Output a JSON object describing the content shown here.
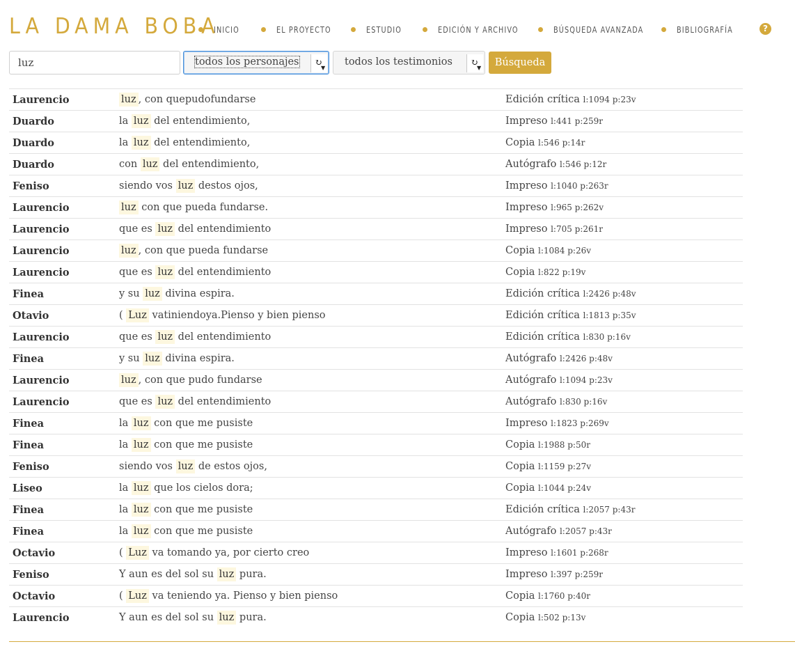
{
  "brand": {
    "title": "LA DAMA BOBA",
    "accent": "#d4a93c"
  },
  "nav": [
    {
      "label": "INICIO"
    },
    {
      "label": "EL PROYECTO"
    },
    {
      "label": "ESTUDIO"
    },
    {
      "label": "EDICIÓN Y ARCHIVO"
    },
    {
      "label": "BÚSQUEDA AVANZADA"
    },
    {
      "label": "BIBLIOGRAFÍA"
    }
  ],
  "help": {
    "icon": "question-circle-icon",
    "glyph": "?"
  },
  "search": {
    "query": "luz",
    "character_select": "todos los personajes",
    "witness_select": "todos los testimonios",
    "button_label": "Búsqueda"
  },
  "results": [
    {
      "character": "Laurencio",
      "pre": "",
      "match": "luz",
      "post": ", con quepudofundarse",
      "source": "Edición crítica",
      "ref": "l:1094 p:23v"
    },
    {
      "character": "Duardo",
      "pre": "la ",
      "match": "luz",
      "post": " del entendimiento,",
      "source": "Impreso",
      "ref": "l:441 p:259r"
    },
    {
      "character": "Duardo",
      "pre": "la ",
      "match": "luz",
      "post": " del entendimiento,",
      "source": "Copia",
      "ref": "l:546 p:14r"
    },
    {
      "character": "Duardo",
      "pre": "con ",
      "match": "luz",
      "post": " del entendimiento,",
      "source": "Autógrafo",
      "ref": "l:546 p:12r"
    },
    {
      "character": "Feniso",
      "pre": "siendo vos ",
      "match": "luz",
      "post": " destos ojos,",
      "source": "Impreso",
      "ref": "l:1040 p:263r"
    },
    {
      "character": "Laurencio",
      "pre": "",
      "match": "luz",
      "post": " con que pueda fundarse.",
      "source": "Impreso",
      "ref": "l:965 p:262v"
    },
    {
      "character": "Laurencio",
      "pre": "que es ",
      "match": "luz",
      "post": " del entendimiento",
      "source": "Impreso",
      "ref": "l:705 p:261r"
    },
    {
      "character": "Laurencio",
      "pre": "",
      "match": "luz",
      "post": ", con que pueda fundarse",
      "source": "Copia",
      "ref": "l:1084 p:26v"
    },
    {
      "character": "Laurencio",
      "pre": "que es ",
      "match": "luz",
      "post": " del entendimiento",
      "source": "Copia",
      "ref": "l:822 p:19v"
    },
    {
      "character": "Finea",
      "pre": "y su ",
      "match": "luz",
      "post": " divina espira.",
      "source": "Edición crítica",
      "ref": "l:2426 p:48v"
    },
    {
      "character": "Otavio",
      "pre": "( ",
      "match": "Luz",
      "post": " vatiniendoya.Pienso y bien pienso",
      "source": "Edición crítica",
      "ref": "l:1813 p:35v"
    },
    {
      "character": "Laurencio",
      "pre": "que es ",
      "match": "luz",
      "post": " del entendimiento",
      "source": "Edición crítica",
      "ref": "l:830 p:16v"
    },
    {
      "character": "Finea",
      "pre": "y su ",
      "match": "luz",
      "post": " divina espira.",
      "source": "Autógrafo",
      "ref": "l:2426 p:48v"
    },
    {
      "character": "Laurencio",
      "pre": "",
      "match": "luz",
      "post": ", con que pudo fundarse",
      "source": "Autógrafo",
      "ref": "l:1094 p:23v"
    },
    {
      "character": "Laurencio",
      "pre": "que es ",
      "match": "luz",
      "post": " del entendimiento",
      "source": "Autógrafo",
      "ref": "l:830 p:16v"
    },
    {
      "character": "Finea",
      "pre": "la ",
      "match": "luz",
      "post": " con que me pusiste",
      "source": "Impreso",
      "ref": "l:1823 p:269v"
    },
    {
      "character": "Finea",
      "pre": "la ",
      "match": "luz",
      "post": " con que me pusiste",
      "source": "Copia",
      "ref": "l:1988 p:50r"
    },
    {
      "character": "Feniso",
      "pre": "siendo vos ",
      "match": "luz",
      "post": " de estos ojos,",
      "source": "Copia",
      "ref": "l:1159 p:27v"
    },
    {
      "character": "Liseo",
      "pre": "la ",
      "match": "luz",
      "post": " que los cielos dora;",
      "source": "Copia",
      "ref": "l:1044 p:24v"
    },
    {
      "character": "Finea",
      "pre": "la ",
      "match": "luz",
      "post": " con que me pusiste",
      "source": "Edición crítica",
      "ref": "l:2057 p:43r"
    },
    {
      "character": "Finea",
      "pre": "la ",
      "match": "luz",
      "post": " con que me pusiste",
      "source": "Autógrafo",
      "ref": "l:2057 p:43r"
    },
    {
      "character": "Octavio",
      "pre": "( ",
      "match": "Luz",
      "post": " va tomando ya, por cierto creo",
      "source": "Impreso",
      "ref": "l:1601 p:268r"
    },
    {
      "character": "Feniso",
      "pre": "Y aun es del sol su ",
      "match": "luz",
      "post": " pura.",
      "source": "Impreso",
      "ref": "l:397 p:259r"
    },
    {
      "character": "Octavio",
      "pre": "( ",
      "match": "Luz",
      "post": " va teniendo ya. Pienso y bien pienso",
      "source": "Copia",
      "ref": "l:1760 p:40r"
    },
    {
      "character": "Laurencio",
      "pre": "Y aun es del sol su ",
      "match": "luz",
      "post": " pura.",
      "source": "Copia",
      "ref": "l:502 p:13v"
    }
  ]
}
